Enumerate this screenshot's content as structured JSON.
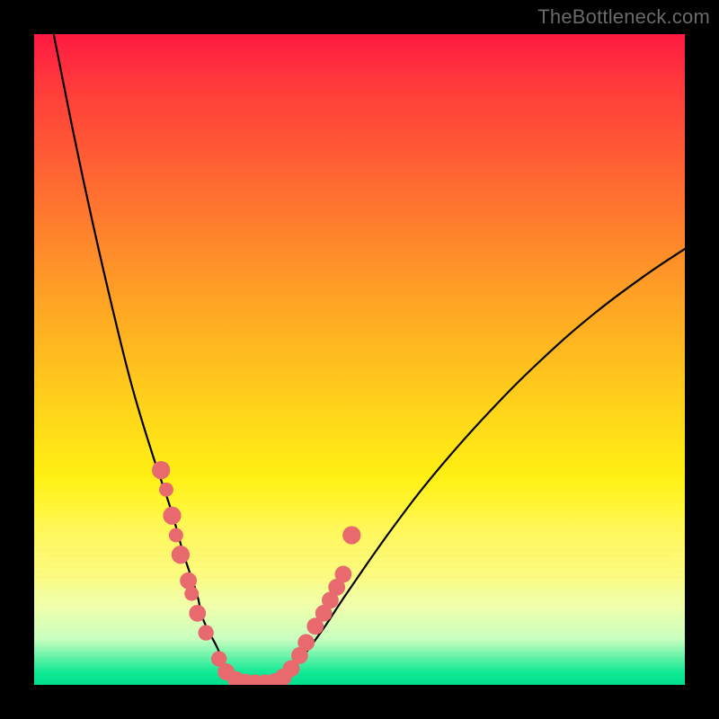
{
  "watermark": "TheBottleneck.com",
  "colors": {
    "curve": "#000000",
    "marker_fill": "#e86a6e",
    "marker_stroke": "#c94a50",
    "frame_bg_top": "#ff1a42",
    "frame_bg_bottom": "#00e08c",
    "page_bg": "#000000"
  },
  "chart_data": {
    "type": "line",
    "title": "",
    "xlabel": "",
    "ylabel": "",
    "xlim": [
      0,
      100
    ],
    "ylim": [
      0,
      100
    ],
    "grid": false,
    "legend": false,
    "series": [
      {
        "name": "bottleneck-curve",
        "x": [
          3,
          6,
          9,
          12,
          15,
          18,
          21,
          23,
          25,
          26,
          28,
          30,
          33,
          36,
          40,
          44,
          48,
          55,
          62,
          70,
          78,
          86,
          94,
          100
        ],
        "y": [
          100,
          85,
          71,
          58,
          46,
          36,
          27,
          20,
          14,
          10,
          6,
          2,
          0,
          0,
          3,
          8,
          14,
          24,
          33,
          42,
          50,
          57,
          63,
          67
        ]
      }
    ],
    "markers": [
      {
        "x": 19.5,
        "y": 33,
        "r": 1.4
      },
      {
        "x": 20.3,
        "y": 30,
        "r": 1.1
      },
      {
        "x": 21.2,
        "y": 26,
        "r": 1.4
      },
      {
        "x": 21.8,
        "y": 23,
        "r": 1.1
      },
      {
        "x": 22.5,
        "y": 20,
        "r": 1.4
      },
      {
        "x": 23.7,
        "y": 16,
        "r": 1.3
      },
      {
        "x": 24.2,
        "y": 14,
        "r": 1.1
      },
      {
        "x": 25.1,
        "y": 11,
        "r": 1.3
      },
      {
        "x": 26.4,
        "y": 8,
        "r": 1.2
      },
      {
        "x": 28.4,
        "y": 4,
        "r": 1.2
      },
      {
        "x": 29.5,
        "y": 2,
        "r": 1.3
      },
      {
        "x": 31.0,
        "y": 0.8,
        "r": 1.3
      },
      {
        "x": 32.5,
        "y": 0.4,
        "r": 1.3
      },
      {
        "x": 34.0,
        "y": 0.3,
        "r": 1.3
      },
      {
        "x": 35.5,
        "y": 0.3,
        "r": 1.3
      },
      {
        "x": 37.0,
        "y": 0.5,
        "r": 1.3
      },
      {
        "x": 38.3,
        "y": 1.2,
        "r": 1.3
      },
      {
        "x": 39.5,
        "y": 2.5,
        "r": 1.3
      },
      {
        "x": 40.8,
        "y": 4.5,
        "r": 1.3
      },
      {
        "x": 41.8,
        "y": 6.5,
        "r": 1.3
      },
      {
        "x": 43.2,
        "y": 9,
        "r": 1.3
      },
      {
        "x": 44.5,
        "y": 11,
        "r": 1.3
      },
      {
        "x": 45.5,
        "y": 13,
        "r": 1.3
      },
      {
        "x": 46.5,
        "y": 15,
        "r": 1.3
      },
      {
        "x": 47.5,
        "y": 17,
        "r": 1.3
      },
      {
        "x": 48.8,
        "y": 23,
        "r": 1.4
      }
    ]
  }
}
